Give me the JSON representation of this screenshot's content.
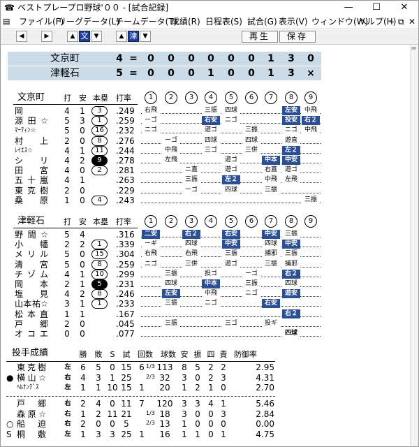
{
  "titlebar": {
    "title": "ベストプレープロ野球'００ - [試合記録]",
    "app_icon": "☎",
    "minimize": "—",
    "maximize": "☐",
    "close": "✕"
  },
  "menubar": {
    "items": [
      "ファイル(F)",
      "リーグデータ(L)",
      "チームデータ(T)",
      "成績(R)",
      "日程表(S)",
      "試合(G)",
      "表示(V)",
      "ウィンドウ(W)",
      "ヘルプ(H)"
    ],
    "mdi_minimize": "‒",
    "mdi_restore": "⧉",
    "mdi_close": "✕"
  },
  "toolbar": {
    "prev": "◀",
    "next": "▶",
    "bun_up": "▲",
    "bun_label": "文",
    "bun_down": "▼",
    "tsu_up": "▲",
    "tsu_label": "津",
    "tsu_down": "▼",
    "replay": "再生",
    "save": "保存"
  },
  "scoreboard": [
    {
      "team": "文京町",
      "total": "4",
      "eq": "=",
      "innings": [
        "0",
        "0",
        "0",
        "0",
        "0",
        "0",
        "1",
        "3",
        "0"
      ]
    },
    {
      "team": "津軽石",
      "total": "5",
      "eq": "=",
      "innings": [
        "0",
        "0",
        "0",
        "1",
        "0",
        "0",
        "1",
        "3",
        "×"
      ]
    }
  ],
  "inning_numbers": [
    "1",
    "2",
    "3",
    "4",
    "5",
    "6",
    "7",
    "8",
    "9"
  ],
  "headers": {
    "at_bats": "打",
    "hits": "安",
    "hr": "本塁",
    "avg": "打率"
  },
  "team1": {
    "name": "文京町",
    "batters": [
      {
        "name": "岡",
        "ab": "4",
        "h": "1",
        "hr": "3",
        "avg": ".249",
        "pa": [
          [
            "右飛",
            ""
          ],
          [],
          [],
          [
            "三振",
            ""
          ],
          [
            "四球",
            ""
          ],
          [],
          [],
          [
            "左安",
            "hl"
          ],
          [
            "中飛",
            ""
          ]
        ]
      },
      {
        "name": "源田☆",
        "ab": "5",
        "h": "3",
        "hr": "1",
        "avg": ".259",
        "pa": [
          [
            "ーゴ",
            ""
          ],
          [],
          [],
          [
            "右安",
            "hl"
          ],
          [
            "ニゴ",
            ""
          ],
          [],
          [],
          [
            "投安",
            "hl"
          ],
          [
            "右２",
            "hl"
          ]
        ]
      },
      {
        "name": "ﾏｰﾃｨﾝ☆",
        "ab": "5",
        "h": "0",
        "hr": "16",
        "avg": ".232",
        "pa": [
          [
            "ニゴ",
            ""
          ],
          [],
          [],
          [
            "遊ゴ",
            ""
          ],
          [],
          [
            "三振",
            ""
          ],
          [],
          [
            "ニゴ",
            ""
          ],
          [
            "中飛",
            ""
          ]
        ]
      },
      {
        "name": "村 上",
        "ab": "2",
        "h": "0",
        "hr": "8",
        "avg": ".276",
        "pa": [
          [],
          [
            "ーゴ",
            ""
          ],
          [],
          [
            "四球",
            ""
          ],
          [],
          [
            "四球",
            ""
          ],
          [],
          [
            "遊直",
            ""
          ],
          []
        ]
      },
      {
        "name": "ﾚｲｴｽ☆",
        "ab": "4",
        "h": "1",
        "hr": "11",
        "avg": ".244",
        "pa": [
          [],
          [
            "中飛",
            ""
          ],
          [],
          [
            "三ゴ",
            ""
          ],
          [],
          [
            "三併",
            ""
          ],
          [],
          [
            "左２",
            "hl"
          ],
          []
        ]
      },
      {
        "name": "シ リ",
        "ab": "4",
        "h": "2",
        "hr": "9",
        "avg": ".278",
        "hr_selected": true,
        "pa": [
          [],
          [
            "左飛",
            ""
          ],
          [],
          [],
          [
            "遊ゴ",
            ""
          ],
          [],
          [
            "中本",
            "hl"
          ],
          [
            "中安",
            "hl"
          ],
          []
        ]
      },
      {
        "name": "田 宮",
        "ab": "4",
        "h": "0",
        "hr": "2",
        "avg": ".281",
        "pa": [
          [],
          [],
          [
            "ニ直",
            ""
          ],
          [],
          [
            "遊ゴ",
            ""
          ],
          [],
          [
            "右直",
            ""
          ],
          [
            "遊ゴ",
            ""
          ],
          []
        ]
      },
      {
        "name": "五十嵐",
        "ab": "4",
        "h": "1",
        "hr": "",
        "avg": ".263",
        "pa": [
          [],
          [],
          [
            "三振",
            ""
          ],
          [],
          [
            "左２",
            "hl"
          ],
          [],
          [
            "中飛",
            ""
          ],
          [
            "左飛",
            ""
          ],
          []
        ]
      },
      {
        "name": "東克樹",
        "ab": "2",
        "h": "0",
        "hr": "",
        "avg": ".229",
        "pa": [
          [],
          [],
          [
            "ーゴ",
            ""
          ],
          [],
          [
            "四球",
            ""
          ],
          [],
          [
            "三振",
            ""
          ],
          [],
          []
        ]
      },
      {
        "name": "桑 原",
        "ab": "1",
        "h": "0",
        "hr": "4",
        "avg": ".243",
        "pa": [
          [],
          [],
          [],
          [],
          [],
          [],
          [],
          [],
          [
            "三振",
            ""
          ]
        ]
      }
    ]
  },
  "team2": {
    "name": "津軽石",
    "batters": [
      {
        "name": "野間☆",
        "ab": "5",
        "h": "4",
        "hr": "",
        "avg": ".316",
        "pa": [
          [
            "二安",
            "hl"
          ],
          [],
          [
            "右２",
            "hl"
          ],
          [],
          [
            "右安",
            "hl"
          ],
          [],
          [
            "中安",
            "hl"
          ],
          [
            "三振",
            ""
          ],
          []
        ]
      },
      {
        "name": "小 幡",
        "ab": "2",
        "h": "2",
        "hr": "1",
        "avg": ".339",
        "pa": [
          [
            "ーギ",
            ""
          ],
          [],
          [
            "四球",
            ""
          ],
          [],
          [
            "中安",
            "hl"
          ],
          [],
          [
            "四球",
            ""
          ],
          [
            "中安",
            "hl"
          ],
          []
        ]
      },
      {
        "name": "メリル",
        "ab": "5",
        "h": "0",
        "hr": "15",
        "avg": ".304",
        "pa": [
          [
            "右飛",
            ""
          ],
          [],
          [
            "右飛",
            ""
          ],
          [],
          [
            "三振",
            ""
          ],
          [],
          [
            "捕邪",
            ""
          ],
          [
            "三振",
            ""
          ],
          []
        ]
      },
      {
        "name": "清 宮",
        "ab": "5",
        "h": "0",
        "hr": "8",
        "avg": ".259",
        "pa": [
          [
            "ニゴ",
            ""
          ],
          [],
          [
            "三併",
            ""
          ],
          [],
          [
            "遊ゴ",
            ""
          ],
          [],
          [
            "三振",
            ""
          ],
          [
            "捕邪",
            ""
          ],
          []
        ]
      },
      {
        "name": "チゾム",
        "ab": "4",
        "h": "1",
        "hr": "10",
        "avg": ".299",
        "pa": [
          [],
          [
            "三振",
            ""
          ],
          [],
          [
            "投ゴ",
            ""
          ],
          [],
          [
            "ーゴ",
            ""
          ],
          [],
          [
            "右２",
            "hl"
          ],
          []
        ]
      },
      {
        "name": "岡 本",
        "ab": "2",
        "h": "1",
        "hr": "5",
        "avg": ".231",
        "hr_selected": true,
        "pa": [
          [],
          [
            "四球",
            ""
          ],
          [],
          [
            "中本",
            "hl"
          ],
          [],
          [
            "三振",
            ""
          ],
          [],
          [
            "四球",
            ""
          ],
          []
        ]
      },
      {
        "name": "塩 見",
        "ab": "4",
        "h": "2",
        "hr": "8",
        "avg": ".246",
        "pa": [
          [],
          [
            "左安",
            "hl"
          ],
          [],
          [
            "中飛",
            ""
          ],
          [],
          [
            "ニゴ",
            ""
          ],
          [],
          [
            "遊安",
            "hl"
          ],
          []
        ]
      },
      {
        "name": "山本祐☆",
        "ab": "3",
        "h": "1",
        "hr": "1",
        "avg": ".233",
        "pa": [
          [],
          [
            "三振",
            ""
          ],
          [],
          [
            "ニゴ",
            ""
          ],
          [],
          [],
          [
            "右安",
            "hl"
          ],
          [],
          []
        ]
      },
      {
        "name": "松本直",
        "ab": "1",
        "h": "1",
        "hr": "",
        "avg": ".167",
        "pa": [
          [],
          [],
          [],
          [],
          [],
          [],
          [],
          [
            "右２",
            "hl"
          ],
          []
        ]
      },
      {
        "name": "戸 郷",
        "ab": "2",
        "h": "0",
        "hr": "",
        "avg": ".045",
        "pa": [
          [],
          [
            "三振",
            ""
          ],
          [],
          [],
          [
            "三ゴ",
            ""
          ],
          [],
          [
            "投ギ",
            ""
          ],
          [],
          []
        ]
      },
      {
        "name": "オコエ",
        "ab": "0",
        "h": "0",
        "hr": "",
        "avg": ".077",
        "pa": [
          [],
          [],
          [],
          [],
          [],
          [],
          [],
          [
            "四球",
            "pl"
          ],
          []
        ]
      }
    ]
  },
  "pitching": {
    "title": "投手成績",
    "headers": [
      "勝",
      "敗",
      "S",
      "試",
      "回数",
      "球数",
      "安",
      "振",
      "四",
      "責",
      "防御率"
    ],
    "team1": [
      {
        "mark": "",
        "name": "東克樹",
        "hand": "左",
        "w": "6",
        "l": "5",
        "s": "0",
        "g": "15",
        "ip": "6",
        "ip_frac": "1/3",
        "pitches": "113",
        "h": "8",
        "so": "5",
        "bb": "2",
        "er": "2",
        "era": "2.95"
      },
      {
        "mark": "●",
        "name": "横山☆",
        "hand": "右",
        "w": "4",
        "l": "3",
        "s": "1",
        "g": "25",
        "ip": "",
        "ip_frac": "2/3",
        "pitches": "32",
        "h": "3",
        "so": "0",
        "bb": "2",
        "er": "3",
        "era": "4.31"
      },
      {
        "mark": "",
        "name": "ﾍﾙﾅﾝﾃﾞｽ",
        "hand": "左",
        "w": "1",
        "l": "1",
        "s": "10",
        "g": "15",
        "ip": "1",
        "ip_frac": "",
        "pitches": "20",
        "h": "1",
        "so": "2",
        "bb": "1",
        "er": "0",
        "era": "2.70"
      }
    ],
    "team2": [
      {
        "mark": "",
        "name": "戸 郷",
        "hand": "右",
        "w": "2",
        "l": "4",
        "s": "0",
        "g": "11",
        "ip": "7",
        "ip_frac": "",
        "pitches": "120",
        "h": "3",
        "so": "3",
        "bb": "4",
        "er": "1",
        "era": "5.46"
      },
      {
        "mark": "",
        "name": "森原☆",
        "hand": "右",
        "w": "1",
        "l": "2",
        "s": "11",
        "g": "21",
        "ip": "",
        "ip_frac": "1/3",
        "pitches": "18",
        "h": "3",
        "so": "0",
        "bb": "0",
        "er": "3",
        "era": "2.84"
      },
      {
        "mark": "○",
        "name": "船 迫",
        "hand": "右",
        "w": "2",
        "l": "0",
        "s": "0",
        "g": "5",
        "ip": "",
        "ip_frac": "2/3",
        "pitches": "13",
        "h": "1",
        "so": "0",
        "bb": "0",
        "er": "0",
        "era": "0.00"
      },
      {
        "mark": "S",
        "name": "桐 敷",
        "hand": "左",
        "w": "1",
        "l": "3",
        "s": "3",
        "g": "25",
        "ip": "1",
        "ip_frac": "",
        "pitches": "16",
        "h": "1",
        "so": "1",
        "bb": "0",
        "er": "1",
        "era": "4.75"
      }
    ]
  }
}
